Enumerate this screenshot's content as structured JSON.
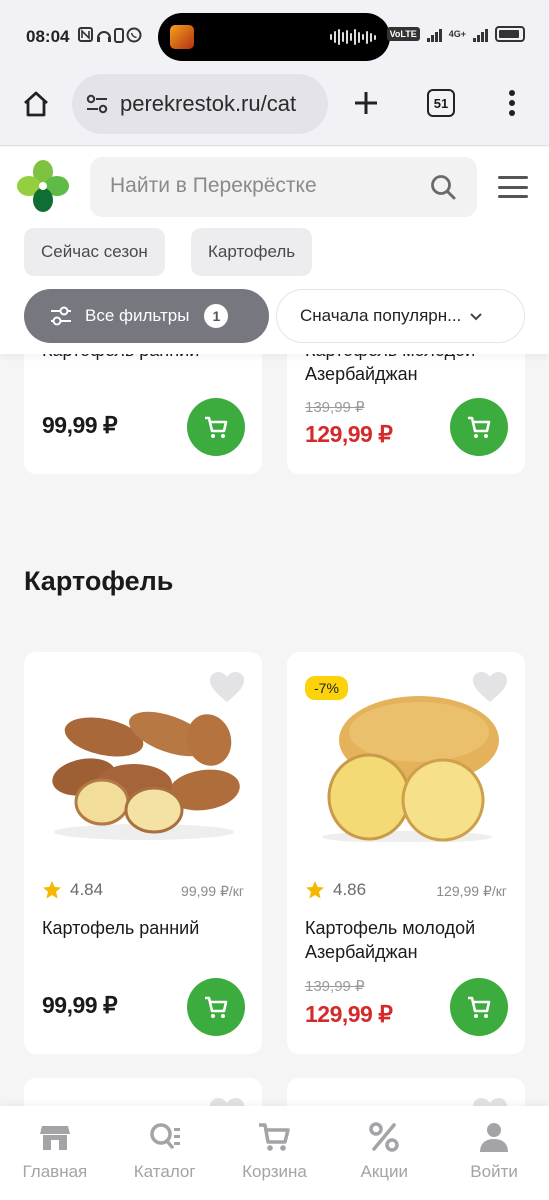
{
  "status_bar": {
    "time": "08:04",
    "network": "4G+",
    "volte": "VoLTE"
  },
  "browser": {
    "url": "perekrestok.ru/cat",
    "tab_count": "51"
  },
  "header": {
    "search_placeholder": "Найти в Перекрёстке",
    "chips": [
      "Сейчас сезон",
      "Картофель"
    ],
    "filters_label": "Все фильтры",
    "filters_count": "1",
    "sort_label": "Сначала популярн..."
  },
  "top_cards": [
    {
      "name": "Картофель ранний",
      "price": "99,99 ₽"
    },
    {
      "name_line1": "Картофель молодой",
      "name_line2": "Азербайджан",
      "old_price": "139,99 ₽",
      "price": "129,99 ₽"
    }
  ],
  "section_title": "Картофель",
  "products": [
    {
      "rating": "4.84",
      "unit_price": "99,99 ₽/кг",
      "name": "Картофель ранний",
      "price": "99,99 ₽"
    },
    {
      "discount": "-7%",
      "rating": "4.86",
      "unit_price": "129,99 ₽/кг",
      "name": "Картофель молодой Азербайджан",
      "old_price": "139,99 ₽",
      "price": "129,99 ₽"
    }
  ],
  "bottom_nav": [
    {
      "label": "Главная",
      "icon": "store-icon"
    },
    {
      "label": "Каталог",
      "icon": "catalog-icon"
    },
    {
      "label": "Корзина",
      "icon": "cart-icon"
    },
    {
      "label": "Акции",
      "icon": "percent-icon"
    },
    {
      "label": "Войти",
      "icon": "user-icon"
    }
  ],
  "colors": {
    "brand_green": "#3dac3e",
    "sale_red": "#d32b2b",
    "discount_yellow": "#fcd20a",
    "filters_gray": "#76777f"
  }
}
